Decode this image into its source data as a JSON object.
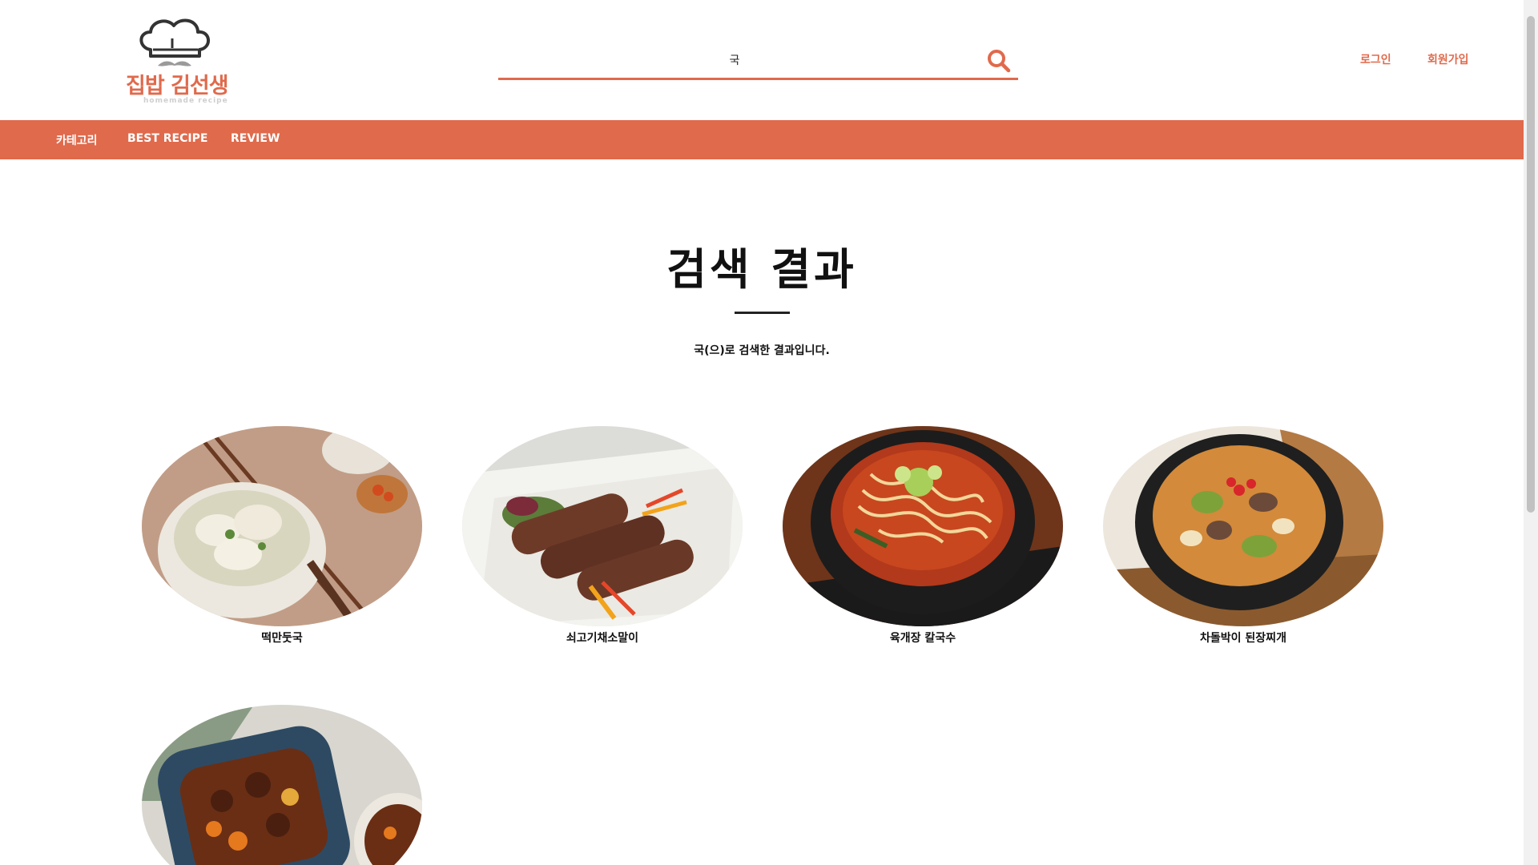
{
  "header": {
    "logo_text": "집밥 김선생",
    "logo_sub": "homemade recipe",
    "search_value": "국",
    "login": "로그인",
    "signup": "회원가입"
  },
  "nav": {
    "items": [
      "카테고리",
      "BEST RECIPE",
      "REVIEW"
    ]
  },
  "main": {
    "title": "검색 결과",
    "subtitle": "국(으)로 검색한 결과입니다."
  },
  "results": [
    {
      "name": "떡만둣국",
      "icon": "dumpling-soup-photo"
    },
    {
      "name": "쇠고기채소말이",
      "icon": "beef-vegetable-roll-photo"
    },
    {
      "name": "육개장 칼국수",
      "icon": "spicy-noodle-soup-photo"
    },
    {
      "name": "차돌박이 된장찌개",
      "icon": "soybean-stew-photo"
    },
    {
      "name": "",
      "icon": "beef-stew-photo"
    }
  ],
  "colors": {
    "accent": "#e06a4c",
    "text": "#111111"
  }
}
